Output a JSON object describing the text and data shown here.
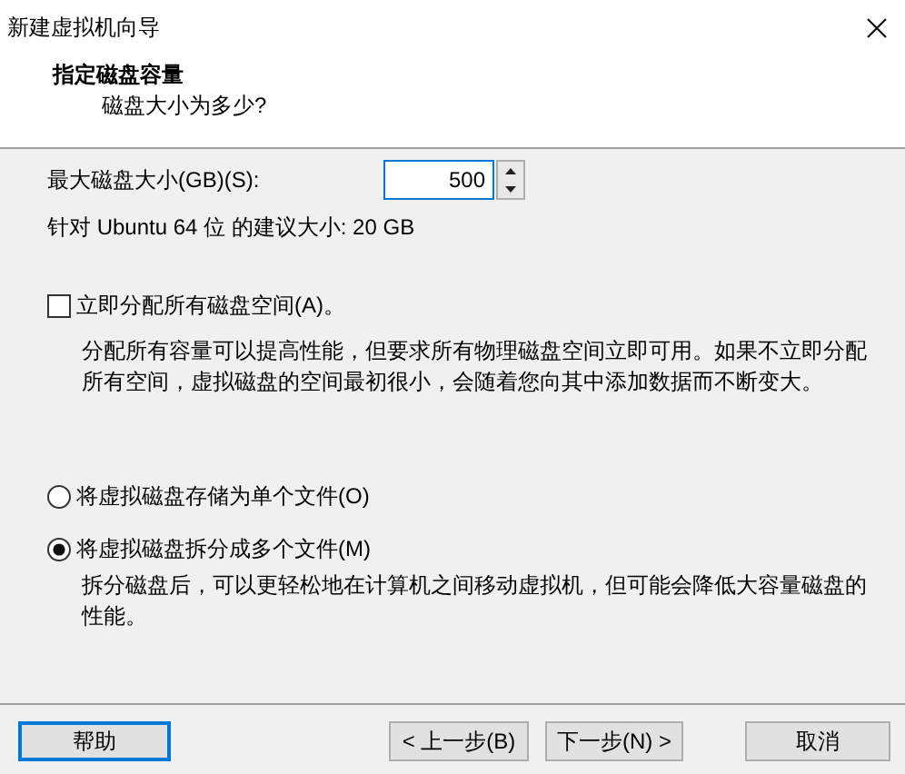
{
  "window": {
    "title": "新建虚拟机向导"
  },
  "header": {
    "title": "指定磁盘容量",
    "subtitle": "磁盘大小为多少?"
  },
  "disk_size": {
    "label": "最大磁盘大小(GB)(S):",
    "value": "500",
    "focused": true
  },
  "recommendation": "针对 Ubuntu 64 位 的建议大小: 20 GB",
  "allocate_now": {
    "label": "立即分配所有磁盘空间(A)。",
    "checked": false,
    "description": "分配所有容量可以提高性能，但要求所有物理磁盘空间立即可用。如果不立即分配所有空间，虚拟磁盘的空间最初很小，会随着您向其中添加数据而不断变大。"
  },
  "storage_options": [
    {
      "label": "将虚拟磁盘存储为单个文件(O)",
      "selected": false
    },
    {
      "label": "将虚拟磁盘拆分成多个文件(M)",
      "selected": true,
      "description": "拆分磁盘后，可以更轻松地在计算机之间移动虚拟机，但可能会降低大容量磁盘的性能。"
    }
  ],
  "buttons": [
    {
      "label": "帮助",
      "focused": true
    },
    {
      "label": "< 上一步(B)",
      "focused": false
    },
    {
      "label": "下一步(N) >",
      "focused": false
    },
    {
      "label": "取消",
      "focused": false
    }
  ]
}
